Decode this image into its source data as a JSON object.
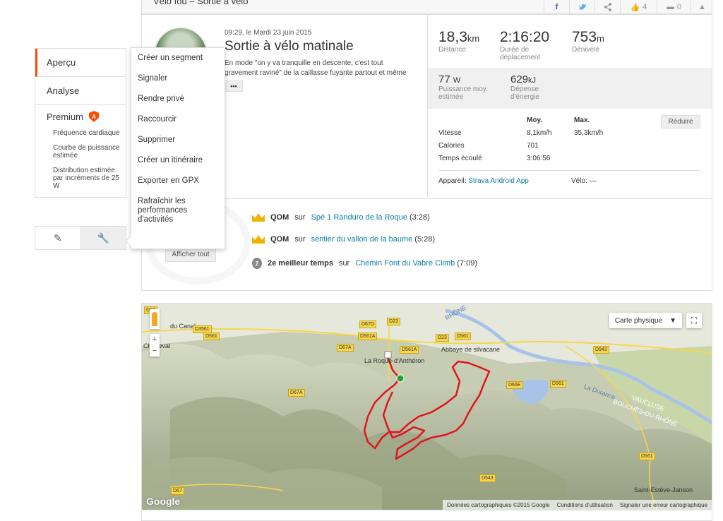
{
  "header": {
    "title": "Vélo fou – Sortie à vélo",
    "facebook_label": "f",
    "twitter_label": "t",
    "kudos_count": "4",
    "comment_count": "0"
  },
  "nav": {
    "items": [
      {
        "label": "Aperçu"
      },
      {
        "label": "Analyse"
      }
    ],
    "premium": {
      "label": "Premium",
      "badge": "A",
      "sub_items": [
        {
          "label": "Fréquence cardiaque"
        },
        {
          "label": "Courbe de puissance estimée"
        },
        {
          "label": "Distribution estimée par incréments de 25 W"
        }
      ]
    }
  },
  "dropdown": {
    "items": [
      {
        "label": "Créer un segment"
      },
      {
        "label": "Signaler"
      },
      {
        "label": "Rendre privé"
      },
      {
        "label": "Raccourcir"
      },
      {
        "label": "Supprimer"
      },
      {
        "label": "Créer un itinéraire"
      },
      {
        "label": "Exporter en GPX"
      },
      {
        "label": "Rafraîchir les performances d'activités"
      }
    ]
  },
  "activity": {
    "date": "09:29, le Mardi 23 juin 2015",
    "title": "Sortie à vélo matinale",
    "description": "En mode \"on y va tranquille en descente, c'est tout gravement raviné\" de la caillasse fuyante partout et même",
    "more_label": "•••",
    "show_all_label": "Afficher tout"
  },
  "stats": {
    "distance": {
      "value": "18,3",
      "unit": "km",
      "label": "Distance"
    },
    "moving_time": {
      "value": "2:16:20",
      "label": "Durée de déplacement"
    },
    "elevation": {
      "value": "753",
      "unit": "m",
      "label": "Dénivelé"
    },
    "power": {
      "value": "77",
      "unit": "W",
      "label": "Puissance moy. estimée"
    },
    "energy": {
      "value": "629",
      "unit": "kJ",
      "label": "Dépense d'énergie"
    }
  },
  "details": {
    "col_avg": "Moy.",
    "col_max": "Max.",
    "reduce_label": "Réduire",
    "rows": [
      {
        "label": "Vitesse",
        "avg": "8,1km/h",
        "max": "35,3km/h"
      },
      {
        "label": "Calories",
        "avg": "701",
        "max": ""
      },
      {
        "label": "Temps écoulé",
        "avg": "3:06:56",
        "max": ""
      }
    ],
    "device_label": "Appareil:",
    "device_value": "Strava Android App",
    "bike_label": "Vélo:",
    "bike_value": "—"
  },
  "achievements": [
    {
      "icon": "crown-icon",
      "bold": "QOM",
      "mid": "sur",
      "link": "Spé 1 Randuro de la Roque",
      "time": "(3:28)"
    },
    {
      "icon": "crown-icon",
      "bold": "QOM",
      "mid": "sur",
      "link": "sentier du vallon de la baume",
      "time": "(5:28)"
    },
    {
      "icon": "medal-icon",
      "bold": "2e meilleur temps",
      "mid": "sur",
      "link": "Chemin Font du Vabre Climb",
      "time": "(7:09)",
      "badge": "2"
    }
  ],
  "map": {
    "type_label": "Carte physique",
    "footer": {
      "data": "Données cartographiques ©2015 Google",
      "terms": "Conditions d'utilisation",
      "report": "Signaler une erreur cartographique"
    },
    "google": "Google",
    "labels": {
      "rognac": "La Roque-d'Anthéron",
      "abbaye": "Abbaye de silvacane",
      "charleval": "Charleval",
      "canal": "du Canal",
      "durance": "La Durance",
      "vaucluse": "VAUCLUSE",
      "bouches": "BOUCHES-DU-RHÔNE",
      "rhone": "RHÔNE",
      "estieve": "Saint-Estève-Janson"
    },
    "roads": [
      "D27",
      "D3561",
      "D561",
      "D67D",
      "D23",
      "D561A",
      "D67A",
      "D561A",
      "D23",
      "D561",
      "D943",
      "D66E",
      "D561",
      "D67A",
      "D561",
      "D543",
      "D67",
      "D561"
    ]
  },
  "colors": {
    "accent": "#fc4c02",
    "link": "#0a7ea6",
    "route": "#e0141e",
    "start": "#2aa02a"
  }
}
